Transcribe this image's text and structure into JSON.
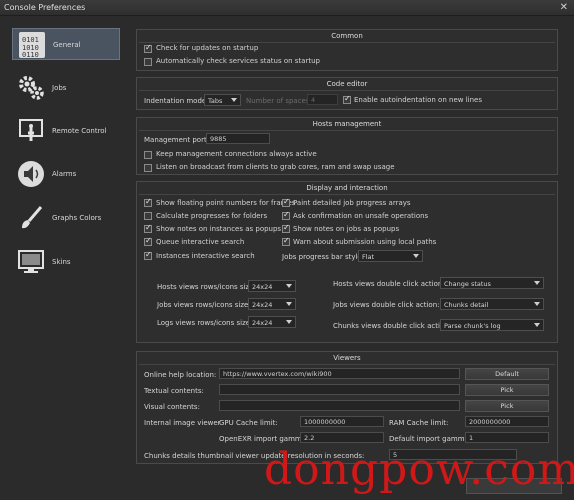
{
  "window": {
    "title": "Console Preferences",
    "close_glyph": "✕"
  },
  "sidebar": {
    "items": [
      {
        "label": "General",
        "icon": "binary-icon",
        "selected": true
      },
      {
        "label": "Jobs",
        "icon": "gears-icon",
        "selected": false
      },
      {
        "label": "Remote Control",
        "icon": "touch-screen-icon",
        "selected": false
      },
      {
        "label": "Alarms",
        "icon": "speaker-icon",
        "selected": false
      },
      {
        "label": "Graphs Colors",
        "icon": "brush-icon",
        "selected": false
      },
      {
        "label": "Skins",
        "icon": "monitor-icon",
        "selected": false
      }
    ]
  },
  "common": {
    "title": "Common",
    "check_updates": {
      "label": "Check for updates on startup",
      "checked": true
    },
    "auto_check_services": {
      "label": "Automatically check services status on startup",
      "checked": false
    }
  },
  "code_editor": {
    "title": "Code editor",
    "indentation_label": "Indentation mode:",
    "indentation_value": "Tabs",
    "spaces_label": "Number of spaces:",
    "spaces_value": "4",
    "auto_indent": {
      "label": "Enable autoindentation on new lines",
      "checked": true
    }
  },
  "hosts_management": {
    "title": "Hosts management",
    "port_label": "Management port:",
    "port_value": "9885",
    "keep_connections": {
      "label": "Keep management connections always active",
      "checked": false
    },
    "listen_broadcast": {
      "label": "Listen on broadcast from clients to grab cores, ram and swap usage",
      "checked": false
    }
  },
  "display": {
    "title": "Display and interaction",
    "left_checks": [
      {
        "label": "Show floating point numbers for frames",
        "checked": true
      },
      {
        "label": "Calculate progresses for folders",
        "checked": false
      },
      {
        "label": "Show notes on instances as popups",
        "checked": true
      },
      {
        "label": "Queue interactive search",
        "checked": true
      },
      {
        "label": "Instances interactive search",
        "checked": true
      }
    ],
    "right_checks": [
      {
        "label": "Paint detailed job progress arrays",
        "checked": true
      },
      {
        "label": "Ask confirmation on unsafe operations",
        "checked": true
      },
      {
        "label": "Show notes on jobs as popups",
        "checked": true
      },
      {
        "label": "Warn about submission using local paths",
        "checked": true
      }
    ],
    "progress_style_label": "Jobs progress bar style:",
    "progress_style_value": "Flat",
    "size_rows": [
      {
        "label": "Hosts views rows/icons size:",
        "value": "24x24"
      },
      {
        "label": "Jobs views rows/icons size:",
        "value": "24x24"
      },
      {
        "label": "Logs views rows/icons size:",
        "value": "24x24"
      }
    ],
    "dbl_click_rows": [
      {
        "label": "Hosts views double click action:",
        "value": "Change status"
      },
      {
        "label": "Jobs views double click action:",
        "value": "Chunks detail"
      },
      {
        "label": "Chunks views double click action:",
        "value": "Parse chunk's log"
      }
    ]
  },
  "viewers": {
    "title": "Viewers",
    "online_help_label": "Online help location:",
    "online_help_value": "https://www.vvertex.com/wiki900",
    "default_button": "Default",
    "textual_label": "Textual contents:",
    "textual_value": "",
    "visual_label": "Visual contents:",
    "visual_value": "",
    "pick_button": "Pick",
    "internal_viewer_label": "Internal image viewer",
    "gpu_cache_label": "GPU Cache limit:",
    "gpu_cache_value": "1000000000",
    "ram_cache_label": "RAM Cache limit:",
    "ram_cache_value": "2000000000",
    "openexr_label": "OpenEXR import gamma:",
    "openexr_value": "2.2",
    "default_gamma_label": "Default import gamma:",
    "default_gamma_value": "1",
    "thumbnail_update_label": "Chunks details thumbnail viewer update resolution in seconds:",
    "thumbnail_update_value": "5"
  },
  "watermark": "dongpow.com"
}
